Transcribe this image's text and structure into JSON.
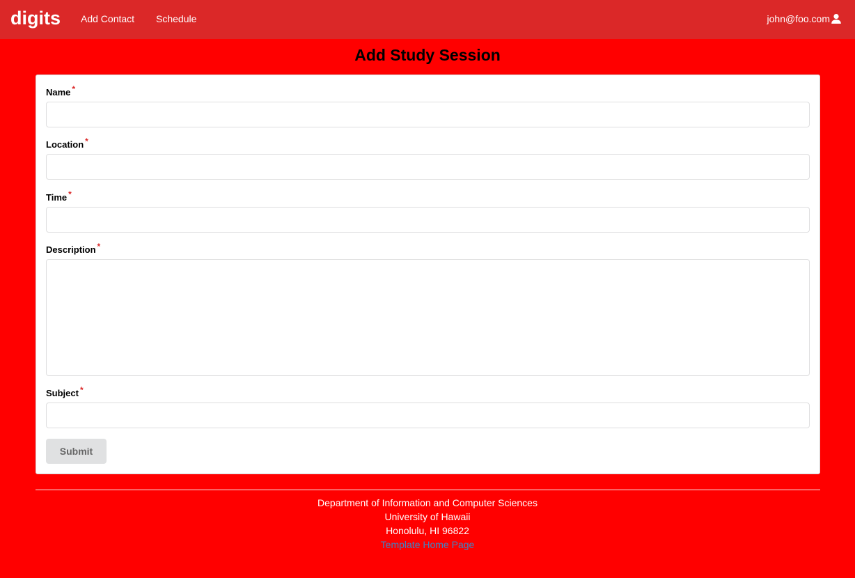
{
  "navbar": {
    "brand": "digits",
    "links": [
      "Add Contact",
      "Schedule"
    ],
    "user": "john@foo.com",
    "user_icon": "user-icon",
    "background_color": "#db2828"
  },
  "page": {
    "title": "Add Study Session",
    "background_color": "#ff0000"
  },
  "form": {
    "fields": [
      {
        "label": "Name",
        "required_marker": "*",
        "value": ""
      },
      {
        "label": "Location",
        "required_marker": "*",
        "value": ""
      },
      {
        "label": "Time",
        "required_marker": "*",
        "value": ""
      },
      {
        "label": "Description",
        "required_marker": "*",
        "value": ""
      },
      {
        "label": "Subject",
        "required_marker": "*",
        "value": ""
      }
    ],
    "submit_label": "Submit"
  },
  "footer": {
    "line1": "Department of Information and Computer Sciences",
    "line2": "University of Hawaii",
    "line3": "Honolulu, HI 96822",
    "link": "Template Home Page",
    "link_color": "#4183c4"
  }
}
